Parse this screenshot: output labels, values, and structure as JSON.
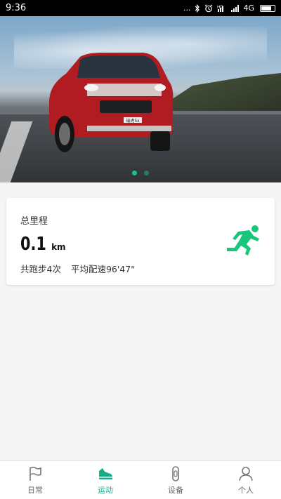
{
  "status_bar": {
    "time": "9:36",
    "dots": "...",
    "network": "4G",
    "icons": [
      "bluetooth-icon",
      "alarm-icon",
      "hd-icon",
      "signal-icon",
      "battery-icon"
    ]
  },
  "banner": {
    "car_plate": "瑞虎5x",
    "slide_count": 2,
    "active_slide": 1
  },
  "summary_card": {
    "title": "总里程",
    "distance_value": "0.1",
    "distance_unit": "km",
    "run_count": "共跑步4次",
    "avg_pace": "平均配速96'47\""
  },
  "tabbar": {
    "tabs": [
      {
        "label": "日常",
        "icon": "flag-icon"
      },
      {
        "label": "运动",
        "icon": "shoe-icon",
        "active": true
      },
      {
        "label": "设备",
        "icon": "band-icon"
      },
      {
        "label": "个人",
        "icon": "person-icon"
      }
    ]
  },
  "colors": {
    "accent": "#1aab8a",
    "runner_green": "#18c77a"
  }
}
